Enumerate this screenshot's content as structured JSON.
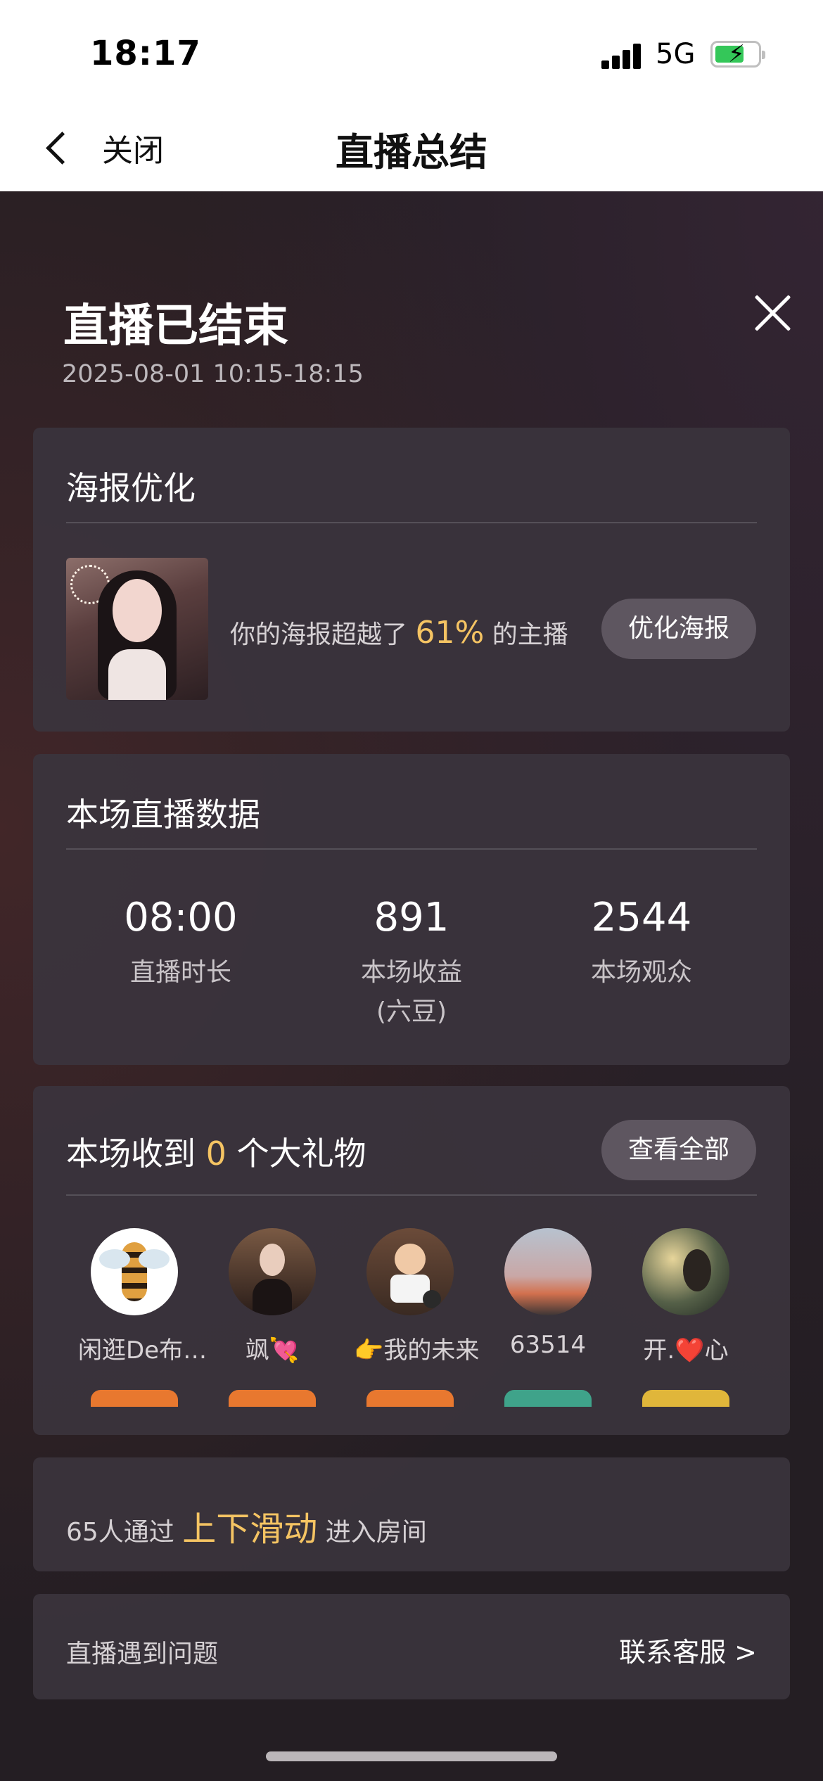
{
  "status_bar": {
    "time": "18:17",
    "network": "5G"
  },
  "nav": {
    "back_label": "关闭",
    "title": "直播总结"
  },
  "summary": {
    "title": "直播已结束",
    "time_range": "2025-08-01 10:15-18:15"
  },
  "poster": {
    "title": "海报优化",
    "text_before": "你的海报超越了 ",
    "percent": "61%",
    "text_after": " 的主播",
    "button": "优化海报"
  },
  "stats": {
    "title": "本场直播数据",
    "items": [
      {
        "value": "08:00",
        "label": "直播时长"
      },
      {
        "value": "891",
        "label": "本场收益",
        "sublabel": "(六豆)"
      },
      {
        "value": "2544",
        "label": "本场观众"
      }
    ]
  },
  "gifts": {
    "title_before": "本场收到 ",
    "count": "0",
    "title_after": " 个大礼物",
    "view_all": "查看全部",
    "gifters": [
      {
        "name": "闲逛De布…",
        "badge_color": "#e8782f"
      },
      {
        "name": "飒💘",
        "badge_color": "#e8782f"
      },
      {
        "name": "👉我的未来",
        "badge_color": "#e8782f"
      },
      {
        "name": "63514",
        "badge_color": "#3fa38a"
      },
      {
        "name": "开.❤️心",
        "badge_color": "#e0b63a"
      }
    ]
  },
  "swipe_tip": {
    "prefix": "65人通过 ",
    "highlight": "上下滑动",
    "suffix": " 进入房间"
  },
  "problem": {
    "label": "直播遇到问题",
    "action": "联系客服 >"
  }
}
